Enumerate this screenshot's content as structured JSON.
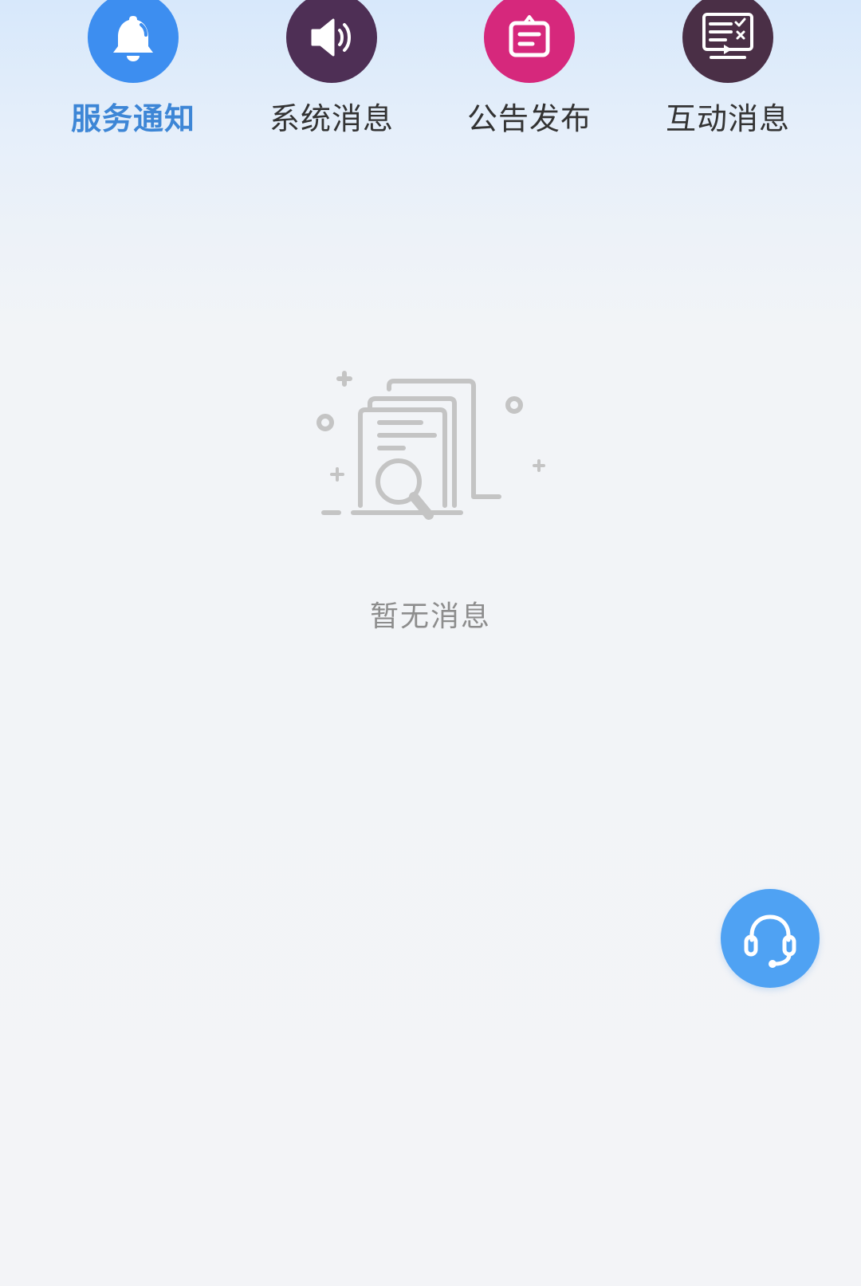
{
  "tabs": [
    {
      "label": "服务通知",
      "icon": "bell-icon",
      "color": "#3d8ef0",
      "label_color": "#3d86d6",
      "active": true
    },
    {
      "label": "系统消息",
      "icon": "speaker-icon",
      "color": "#4e2f55",
      "label_color": "#333333",
      "active": false
    },
    {
      "label": "公告发布",
      "icon": "announcement-board-icon",
      "color": "#d6287c",
      "label_color": "#333333",
      "active": false
    },
    {
      "label": "互动消息",
      "icon": "monitor-checklist-icon",
      "color": "#4a2f46",
      "label_color": "#333333",
      "active": false
    }
  ],
  "empty_state": {
    "icon": "document-search-icon",
    "text": "暂无消息",
    "icon_color": "#c4c4c4"
  },
  "support_button": {
    "icon": "headset-icon",
    "color": "#4fa2f3"
  }
}
